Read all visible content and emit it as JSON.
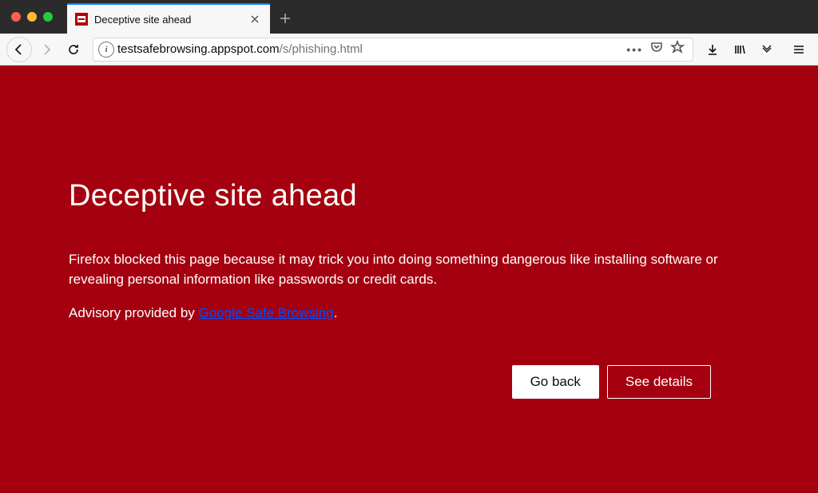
{
  "window": {
    "tab_title": "Deceptive site ahead"
  },
  "url": {
    "domain": "testsafebrowsing.appspot.com",
    "path": "/s/phishing.html"
  },
  "warning": {
    "heading": "Deceptive site ahead",
    "body": "Firefox blocked this page because it may trick you into doing something dangerous like installing software or revealing personal information like passwords or credit cards.",
    "advisory_prefix": "Advisory provided by ",
    "advisory_link_text": "Google Safe Browsing",
    "advisory_suffix": ".",
    "go_back_label": "Go back",
    "see_details_label": "See details"
  }
}
